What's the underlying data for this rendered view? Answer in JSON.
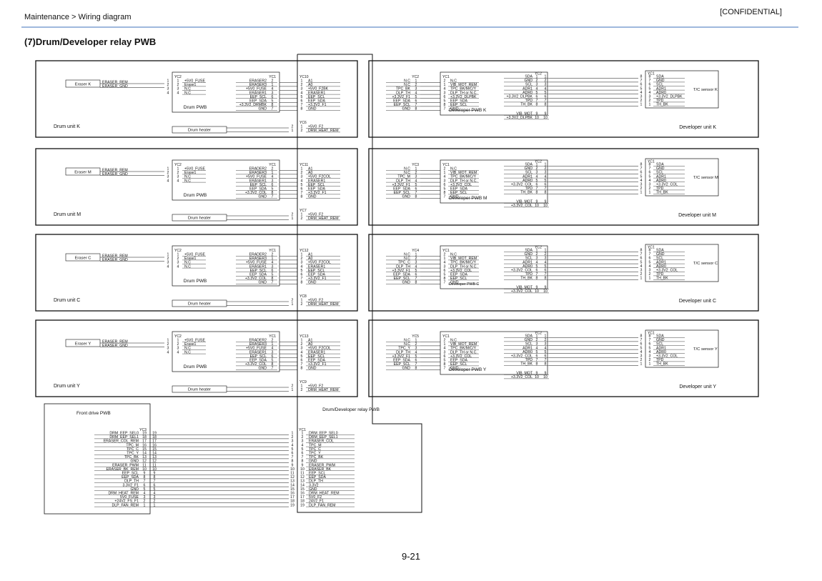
{
  "header": {
    "breadcrumb": "Maintenance > Wiring diagram",
    "confidential": "[CONFIDENTIAL]",
    "title": "(7)Drum/Developer relay PWB"
  },
  "footer": {
    "page_number": "9-21"
  },
  "relay": {
    "label": "Drum/Developer relay PWB",
    "yc1_label": "YC1",
    "front_label": "Front drive PWB",
    "front_yc": "YC3",
    "front_pins": [
      19,
      18,
      17,
      16,
      15,
      14,
      13,
      12,
      11,
      10,
      9,
      8,
      7,
      6,
      5,
      4,
      3,
      2,
      1
    ],
    "front_signals": [
      "DRM_EEP_SEL0",
      "DRM_EEP_SEL1",
      "ERASER_COL_REM",
      "TPC_M",
      "TPC_C",
      "TPC_Y",
      "TPC_BK",
      "GND",
      "ERASER_PWM",
      "ERASER_BK_REM",
      "EEP_SCL",
      "EEP_SDA",
      "DLP_TH",
      "3.3V2_F1",
      "GND",
      "DRM_HEAT_REM",
      "5V0_FUSE",
      "+24V2_FS_F1",
      "DLP_FAN_REM"
    ],
    "relay_pins": [
      1,
      2,
      3,
      4,
      5,
      6,
      7,
      8,
      9,
      10,
      11,
      12,
      13,
      14,
      15,
      16,
      17,
      18,
      19
    ],
    "relay_signals": [
      "DRM_EEP_SEL0",
      "DRM_EEP_SEL1",
      "ERASER_COL",
      "TPC_M",
      "TPC_C",
      "TPC_Y",
      "TPC_BK",
      "GND",
      "ERASER_PWM",
      "ERASER_BK",
      "EEP_SCL",
      "EEP_SDA",
      "DLP_TH",
      "3.3V2",
      "GND",
      "DRM_HEAT_REM",
      "5V0_F2",
      "24V2_F1",
      "DLP_FAN_REM"
    ]
  },
  "drum_units": [
    {
      "unit_label": "Drum unit K",
      "eraser_label": "Eraser K",
      "eraser_signals": [
        "ERASER_REM",
        "ERASER_GND"
      ],
      "yc2_label": "YC2",
      "yc1_label": "YC1",
      "pwb_label": "Drum PWB",
      "yc2_signals": [
        "+5V0_FUSE",
        "Erase1",
        "N.C",
        "N.C"
      ],
      "yc1_signals": [
        "ERASER2",
        "ERASER3",
        "+5V0_FUSE",
        "ERASER1",
        "EEP_SCL",
        "EEP_SDA",
        "+3.3V2_DRMBK",
        "GND"
      ],
      "yc1_pins": [
        2,
        1,
        4,
        3,
        6,
        5,
        8,
        7
      ],
      "relay_yc": "YC10",
      "relay_signals": [
        "A1",
        "A0",
        "+5V0_F2BK",
        "ERASER1",
        "EEP_SCL",
        "EEP_SDA",
        "+3.3V2_F1",
        "GND"
      ],
      "heater_label": "Drum heater",
      "heater_yc": "YC6",
      "heater_signals": [
        "+5V0_F2",
        "DRM_HEAT_REM"
      ]
    },
    {
      "unit_label": "Drum unit M",
      "eraser_label": "Eraser M",
      "eraser_signals": [
        "ERASER_REM",
        "ERASER_GND"
      ],
      "yc2_label": "YC2",
      "yc1_label": "YC1",
      "pwb_label": "Drum PWB",
      "yc2_signals": [
        "+5V0_FUSE",
        "Erase1",
        "N.C",
        "N.C"
      ],
      "yc1_signals": [
        "ERADER2",
        "ERASER3",
        "+5V0_FUSE",
        "ERASER1",
        "EEP_SCL",
        "EEP_SDA",
        "+3.3V2_COL",
        "GND"
      ],
      "yc1_pins": [
        2,
        1,
        4,
        3,
        6,
        5,
        8,
        7
      ],
      "relay_yc": "YC11",
      "relay_signals": [
        "A1",
        "A0",
        "+5V0_F2COL",
        "ERASER1",
        "EEP_SCL",
        "EEP_SDA",
        "+3.3V2_F1",
        "GND"
      ],
      "heater_label": "Drum heater",
      "heater_yc": "YC7",
      "heater_signals": [
        "+5V0_F2",
        "DRM_HEAT_REM"
      ]
    },
    {
      "unit_label": "Drum unit C",
      "eraser_label": "Eraser C",
      "eraser_signals": [
        "ERASER_REM",
        "ERASER_GND"
      ],
      "yc2_label": "YC2",
      "yc1_label": "YC1",
      "pwb_label": "Drum PWB",
      "yc2_signals": [
        "+5V0_FUSE",
        "Erase1",
        "N.C",
        "N.C"
      ],
      "yc1_signals": [
        "ERADER2",
        "ERASER3",
        "+5V0_FUSE",
        "ERASER1",
        "EEP_SCL",
        "EEP_SDA",
        "+3.3V2_COL",
        "GND"
      ],
      "yc1_pins": [
        2,
        1,
        4,
        3,
        6,
        5,
        8,
        7
      ],
      "relay_yc": "YC12",
      "relay_signals": [
        "A1",
        "A0",
        "+5V0_F2COL",
        "ERASER1",
        "EEP_SCL",
        "EEP_SDA",
        "+3.3V2_F1",
        "GND"
      ],
      "heater_label": "Drum heater",
      "heater_yc": "YC8",
      "heater_signals": [
        "+5V0_F2",
        "DRM_HEAT_REM"
      ]
    },
    {
      "unit_label": "Drum unit Y",
      "eraser_label": "Eraser Y",
      "eraser_signals": [
        "ERASER_REM",
        "ERASER_GND"
      ],
      "yc2_label": "YC2",
      "yc1_label": "YC1",
      "pwb_label": "Drum PWB",
      "yc2_signals": [
        "+5V0_FUSE",
        "Erase1",
        "N.C",
        "N.C"
      ],
      "yc1_signals": [
        "ERADER2",
        "ERASER3",
        "+5V0_FUSE",
        "ERASER1",
        "EEP_SCL",
        "EEP_SDA",
        "+3.3V2_COL",
        "GND"
      ],
      "yc1_pins": [
        2,
        1,
        4,
        3,
        6,
        5,
        8,
        7
      ],
      "relay_yc": "YC13",
      "relay_signals": [
        "A1",
        "A0",
        "+5V0_F2COL",
        "ERASER1",
        "EEP_SCL",
        "EEP_SDA",
        "+3.3V2_F1",
        "GND"
      ],
      "heater_label": "Drum heater",
      "heater_yc": "YC9",
      "heater_signals": [
        "+5V0_F2",
        "DRM_HEAT_REM"
      ]
    }
  ],
  "developer_units": [
    {
      "unit_label": "Developer unit K",
      "pwb_label": "Developer PWB K",
      "sensor_label": "T/C sensor K",
      "relay_yc": "YC2",
      "relay_signals": [
        "N.C",
        "N.C",
        "TPC_BK",
        "DLP_TH",
        "+3.3V2_F1",
        "EEP_SDA",
        "EEP_SCL",
        "GND"
      ],
      "dev_yc1_label": "YC1",
      "dev_yc1_pins": [
        2,
        1,
        4,
        3,
        6,
        5,
        8,
        7
      ],
      "dev_yc1_signals": [
        "N.C",
        "VIB_MOT_REM",
        "TPC_BK/M/C/Y",
        "DLP_TH or N.C.",
        "+3.3V2_DLPBK",
        "EEP_SDA",
        "EEP_SCL",
        "GND"
      ],
      "dev_yc2_label": "YC2",
      "dev_yc2_signals": [
        "SDA",
        "GND",
        "SCL",
        "ADR1",
        "ADR0",
        "+3.3V2_DLPBK",
        "TPD",
        "TH_BK"
      ],
      "motor_signals": [
        "VIB_MOT",
        "+3.3V2_DLPBK"
      ],
      "sensor_yc": "YC1",
      "sensor_pins": [
        8,
        7,
        6,
        5,
        4,
        3,
        2,
        1
      ],
      "sensor_signals": [
        "SDA",
        "GND",
        "SCL",
        "ADR1",
        "ADR0",
        "+3.3V2_DLPBK",
        "TPD",
        "TH_BK"
      ]
    },
    {
      "unit_label": "Developer unit M",
      "pwb_label": "Developer PWB M",
      "sensor_label": "T/C sensor M",
      "relay_yc": "YC3",
      "relay_signals": [
        "N.C",
        "N.C",
        "TPC_M",
        "DLP_TH",
        "+3.3V2_F1",
        "EEP_SDA",
        "EEP_SCL",
        "GND"
      ],
      "dev_yc1_label": "YC1",
      "dev_yc1_pins": [
        2,
        1,
        4,
        3,
        6,
        5,
        8,
        7
      ],
      "dev_yc1_signals": [
        "N.C",
        "VIB_MOT_REM",
        "TPC_BK/M/C/Y",
        "DLP_TH or N.C.",
        "+3.3V2_COL",
        "EEP_SDA",
        "EEP_SCL",
        "GND"
      ],
      "dev_yc2_label": "YC2",
      "dev_yc2_signals": [
        "SDA",
        "GND",
        "SCL",
        "ADR1",
        "ADR0",
        "+3.3V2_COL",
        "TPD",
        "TH_BK"
      ],
      "motor_signals": [
        "VIB_MOT",
        "+3.3V2_COL"
      ],
      "sensor_yc": "YC1",
      "sensor_pins": [
        8,
        7,
        6,
        5,
        4,
        3,
        2,
        1
      ],
      "sensor_signals": [
        "SDA",
        "GND",
        "SCL",
        "ADR1",
        "ADR0",
        "+3.3V2_COL",
        "TPD",
        "TH_BK"
      ]
    },
    {
      "unit_label": "Developer unit C",
      "pwb_label": "Developer PWB C",
      "sensor_label": "T/C sensor C",
      "relay_yc": "YC4",
      "relay_signals": [
        "N.C",
        "N.C",
        "TPC_C",
        "DLP_TH",
        "+3.3V2_F1",
        "EEP_SDA",
        "EEP_SCL",
        "GND"
      ],
      "dev_yc1_label": "YC1",
      "dev_yc1_pins": [
        2,
        1,
        4,
        3,
        6,
        5,
        8,
        7
      ],
      "dev_yc1_signals": [
        "N.C",
        "VIB_MOT_REM",
        "TPC_BK/M/C/Y",
        "DLP_TH or N.C.",
        "+3.3V2_COL",
        "EEP_SDA",
        "EEP_SCL",
        "GND"
      ],
      "dev_yc2_label": "YC2",
      "dev_yc2_signals": [
        "SDA",
        "GND",
        "SCL",
        "ADR1",
        "ADR0",
        "+3.3V2_COL",
        "TPD",
        "TH_BK"
      ],
      "motor_signals": [
        "VIB_MOT",
        "+3.3V2_COL"
      ],
      "sensor_yc": "YC1",
      "sensor_pins": [
        8,
        7,
        6,
        5,
        4,
        3,
        2,
        1
      ],
      "sensor_signals": [
        "SDA",
        "GND",
        "SCL",
        "ADR1",
        "ADR0",
        "+3.3V2_COL",
        "TPD",
        "TH_BK"
      ]
    },
    {
      "unit_label": "Developer unit Y",
      "pwb_label": "Developer PWB Y",
      "sensor_label": "T/C sensor Y",
      "relay_yc": "YC5",
      "relay_signals": [
        "N.C",
        "N.C",
        "TPC_Y",
        "DLP_TH",
        "+3.3V2_F1",
        "EEP_SDA",
        "EEP_SCL",
        "GND"
      ],
      "dev_yc1_label": "YC1",
      "dev_yc1_pins": [
        2,
        1,
        4,
        3,
        6,
        5,
        8,
        7
      ],
      "dev_yc1_signals": [
        "N.C",
        "VIB_MOT_REM",
        "TPC_BK/M/C/Y",
        "DLP_TH or N.C.",
        "+3.3V2_COL",
        "EEP_SDA",
        "EEP_SCL",
        "GND"
      ],
      "dev_yc2_label": "YC2",
      "dev_yc2_signals": [
        "SDA",
        "GND",
        "SCL",
        "ADR1",
        "ADR0",
        "+3.3V2_COL",
        "TPD",
        "TH_BK"
      ],
      "motor_signals": [
        "VIB_MOT",
        "+3.3V2_COL"
      ],
      "sensor_yc": "YC1",
      "sensor_pins": [
        8,
        7,
        6,
        5,
        4,
        3,
        2,
        1
      ],
      "sensor_signals": [
        "SDA",
        "GND",
        "SCL",
        "ADR1",
        "ADR0",
        "+3.3V2_COL",
        "TPD",
        "TH_BK"
      ]
    }
  ]
}
